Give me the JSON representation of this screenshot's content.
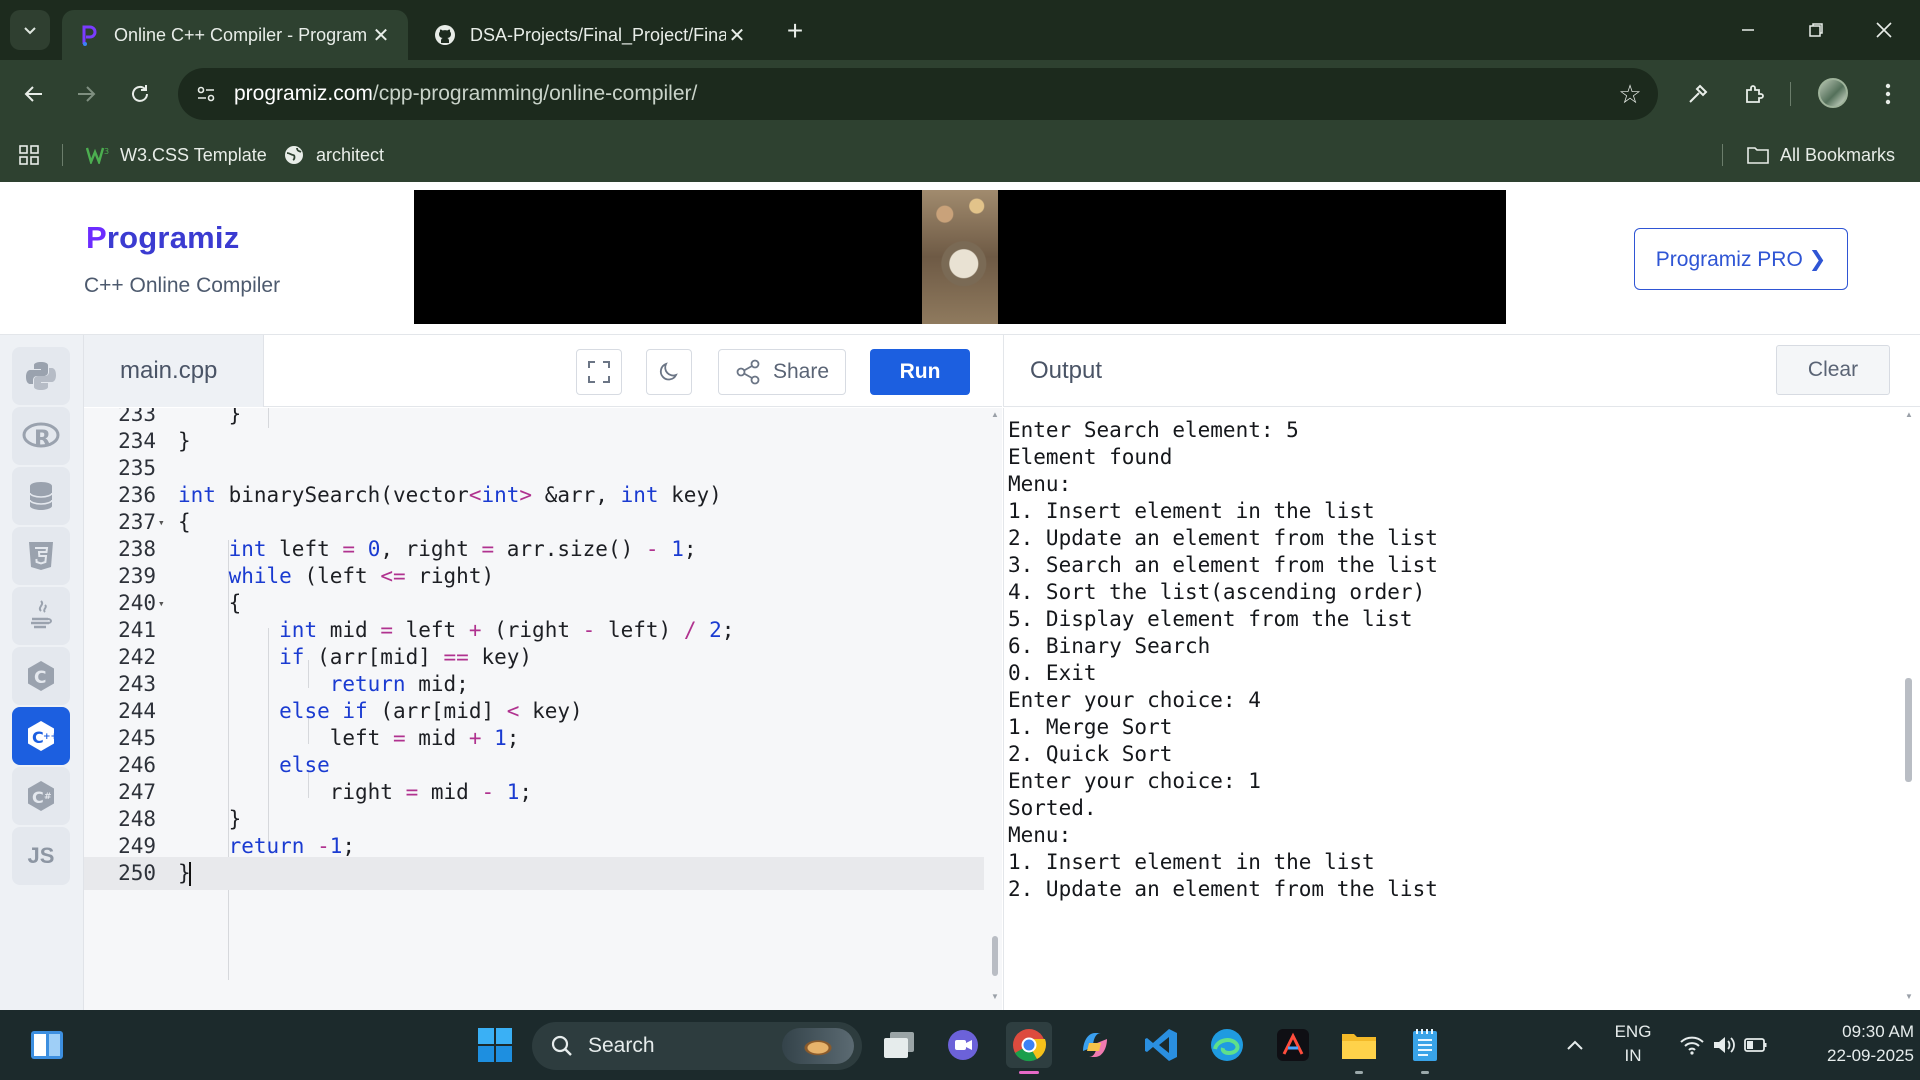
{
  "browser": {
    "tabs": [
      {
        "title": "Online C++ Compiler - Program",
        "active": true
      },
      {
        "title": "DSA-Projects/Final_Project/Fina",
        "active": false
      }
    ],
    "url_host": "programiz.com",
    "url_path": "/cpp-programming/online-compiler/",
    "bookmarks": [
      {
        "label": "W3.CSS Template",
        "icon": "w3-icon"
      },
      {
        "label": "architect",
        "icon": "globe-icon"
      }
    ],
    "all_bookmarks_label": "All Bookmarks"
  },
  "page": {
    "logo": "Programiz",
    "logo_p": "P",
    "logo_rest": "rogramiz",
    "subtitle": "C++ Online Compiler",
    "pro_button": "Programiz PRO ❯"
  },
  "languages": [
    {
      "name": "python-icon",
      "label": ""
    },
    {
      "name": "r-icon",
      "label": "R"
    },
    {
      "name": "sql-icon",
      "label": ""
    },
    {
      "name": "html5-icon",
      "label": "5"
    },
    {
      "name": "java-icon",
      "label": ""
    },
    {
      "name": "c-icon",
      "label": "C"
    },
    {
      "name": "cpp-icon",
      "label": "C",
      "active": true
    },
    {
      "name": "csharp-icon",
      "label": "C"
    },
    {
      "name": "js-icon",
      "label": "JS"
    }
  ],
  "editor": {
    "filename": "main.cpp",
    "share_label": "Share",
    "run_label": "Run",
    "lines": [
      {
        "n": "233",
        "code": "    }"
      },
      {
        "n": "234",
        "code": "}"
      },
      {
        "n": "235",
        "code": ""
      },
      {
        "n": "236",
        "code": "int binarySearch(vector<int> &arr, int key)"
      },
      {
        "n": "237",
        "code": "{",
        "fold": true
      },
      {
        "n": "238",
        "code": "    int left = 0, right = arr.size() - 1;"
      },
      {
        "n": "239",
        "code": "    while (left <= right)"
      },
      {
        "n": "240",
        "code": "    {",
        "fold": true
      },
      {
        "n": "241",
        "code": "        int mid = left + (right - left) / 2;"
      },
      {
        "n": "242",
        "code": "        if (arr[mid] == key)"
      },
      {
        "n": "243",
        "code": "            return mid;"
      },
      {
        "n": "244",
        "code": "        else if (arr[mid] < key)"
      },
      {
        "n": "245",
        "code": "            left = mid + 1;"
      },
      {
        "n": "246",
        "code": "        else"
      },
      {
        "n": "247",
        "code": "            right = mid - 1;"
      },
      {
        "n": "248",
        "code": "    }"
      },
      {
        "n": "249",
        "code": "    return -1;"
      },
      {
        "n": "250",
        "code": "}",
        "active": true
      }
    ]
  },
  "output": {
    "title": "Output",
    "clear_label": "Clear",
    "lines": [
      "Enter Search element: 5",
      "Element found",
      "Menu:",
      "1. Insert element in the list",
      "2. Update an element from the list",
      "3. Search an element from the list",
      "4. Sort the list(ascending order)",
      "5. Display element from the list",
      "6. Binary Search",
      "0. Exit",
      "Enter your choice: 4",
      "1. Merge Sort",
      "2. Quick Sort",
      "Enter your choice: 1",
      "Sorted.",
      "Menu:",
      "1. Insert element in the list",
      "2. Update an element from the list"
    ]
  },
  "taskbar": {
    "search_label": "Search",
    "lang_top": "ENG",
    "lang_bottom": "IN",
    "time": "09:30 AM",
    "date": "22-09-2025"
  },
  "colors": {
    "accent": "#1c5fe0",
    "chrome_dark": "#1d2b1e",
    "chrome": "#2e4130"
  }
}
